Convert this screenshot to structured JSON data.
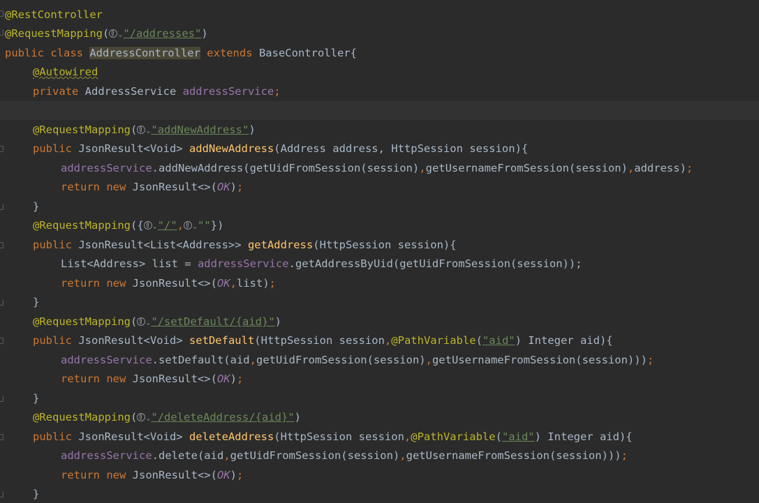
{
  "editor": {
    "language": "Java",
    "theme_colors": {
      "background": "#2b2b2b",
      "annotation": "#bbb529",
      "keyword": "#cc7832",
      "string": "#6a8759",
      "field": "#9876aa",
      "method_declaration": "#ffc66d",
      "plain": "#a9b7c6"
    },
    "tokens": {
      "rest_controller": "@RestController",
      "request_mapping": "@RequestMapping",
      "open_paren": "(",
      "close_paren": ")",
      "path_addresses": "\"/addresses\"",
      "public_class": "public class ",
      "class_name": "AddressController",
      "extends_kw": " extends ",
      "base_class": "BaseController{",
      "autowired": "@Autowired",
      "private_kw": "private ",
      "address_service_type": "AddressService ",
      "address_service_field": "addressService",
      "semicolon": ";",
      "path_add_new": "\"addNewAddress\"",
      "public_kw": "public ",
      "json_result_void": "JsonResult<Void> ",
      "add_new_address_fn": "addNewAddress",
      "add_new_params": "(Address address, HttpSession session){",
      "add_new_call": ".addNewAddress(getUidFromSession(session)",
      "comma": ",",
      "get_username_session": "getUsernameFromSession(session)",
      "address_arg_close": "address)",
      "return_kw": "return new ",
      "json_result_diamond": "JsonResult<>(",
      "ok_const": "OK",
      "close_semicolon": ");",
      "close_brace": "}",
      "mapping_open_brace": "({",
      "path_slash": "\"/\"",
      "path_empty": "\"\"",
      "mapping_close_brace": "})",
      "json_result_list": "JsonResult<List<Address>> ",
      "get_address_fn": "getAddress",
      "get_address_params": "(HttpSession session){",
      "list_decl": "List<Address> list = ",
      "get_by_uid_call": ".getAddressByUid(getUidFromSession(session));",
      "list_arg": "list",
      "path_set_default": "\"/setDefault/{aid}\"",
      "set_default_fn": "setDefault",
      "http_session_param": "(HttpSession session",
      "path_variable": "@PathVariable",
      "aid_string": "\"aid\"",
      "integer_aid": ") Integer aid){",
      "set_default_call": ".setDefault(aid",
      "get_uid_session": "getUidFromSession(session)",
      "get_username_close": "getUsernameFromSession(session))",
      "path_delete": "\"/deleteAddress/{aid}\"",
      "delete_fn": "deleteAddress",
      "delete_call": ".delete(aid"
    }
  }
}
